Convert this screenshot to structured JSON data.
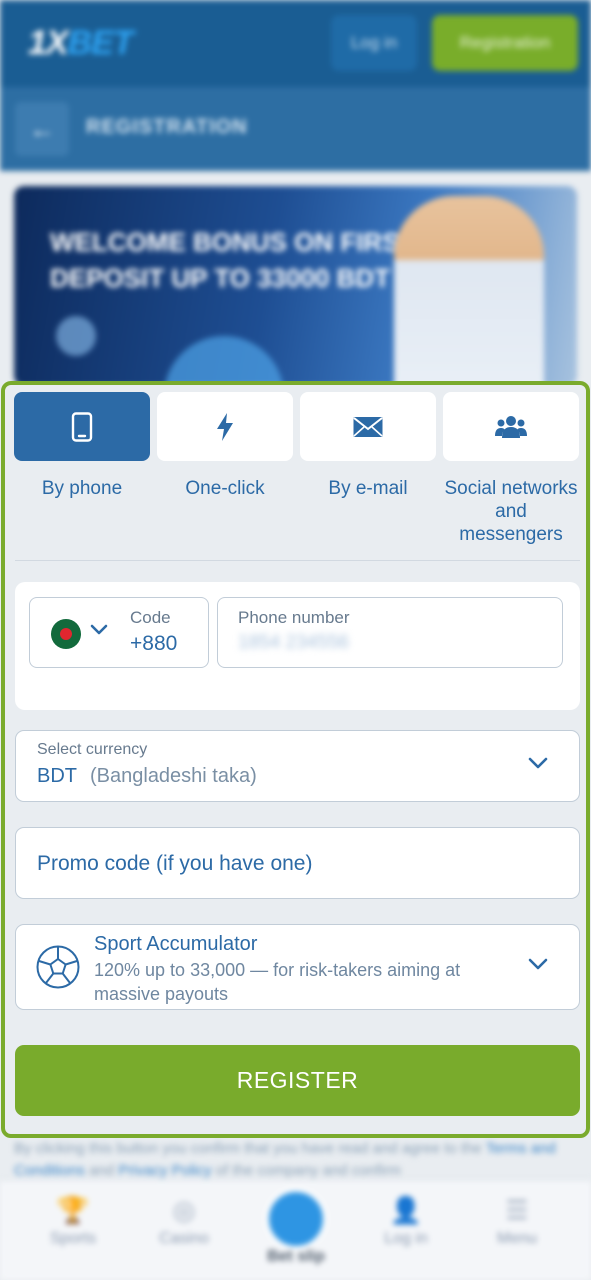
{
  "header": {
    "logo_main": "1X",
    "logo_accent": "BET",
    "login_label": "Log in",
    "registration_label": "Registration"
  },
  "subheader": {
    "back_glyph": "←",
    "title": "REGISTRATION"
  },
  "banner": {
    "line1": "WELCOME BONUS ON FIRST",
    "line2": "DEPOSIT UP TO 33000 BDT"
  },
  "tabs": [
    {
      "label": "By phone",
      "icon": "smartphone-icon",
      "active": true
    },
    {
      "label": "One-click",
      "icon": "lightning-icon",
      "active": false
    },
    {
      "label": "By e-mail",
      "icon": "envelope-icon",
      "active": false
    },
    {
      "label": "Social networks and messengers",
      "icon": "users-icon",
      "active": false
    }
  ],
  "phone_form": {
    "code_label": "Code",
    "code_value": "+880",
    "phone_label": "Phone number",
    "phone_value": "1854 234556"
  },
  "currency": {
    "label": "Select currency",
    "code": "BDT",
    "name": "(Bangladeshi taka)"
  },
  "promo": {
    "placeholder": "Promo code (if you have one)"
  },
  "bonus": {
    "title": "Sport Accumulator",
    "description": "120% up to  33,000 — for risk-takers aiming at massive payouts"
  },
  "register_label": "REGISTER",
  "disclaimer": {
    "text": "By clicking this button you confirm that you have read and agree to the",
    "link1": "Terms and Conditions",
    "joiner": "and",
    "link2": "Privacy Policy",
    "tail": "of the company and confirm"
  },
  "bottom_nav": [
    {
      "label": "Sports",
      "icon": "trophy-icon"
    },
    {
      "label": "Casino",
      "icon": "casino-chip-icon"
    },
    {
      "label": "Bet slip",
      "icon": "ticket-icon"
    },
    {
      "label": "Log in",
      "icon": "user-icon"
    },
    {
      "label": "Menu",
      "icon": "menu-icon"
    }
  ],
  "colors": {
    "brand_blue": "#2c6aa6",
    "accent_green": "#79ab2c",
    "header_blue": "#1a5d93"
  }
}
